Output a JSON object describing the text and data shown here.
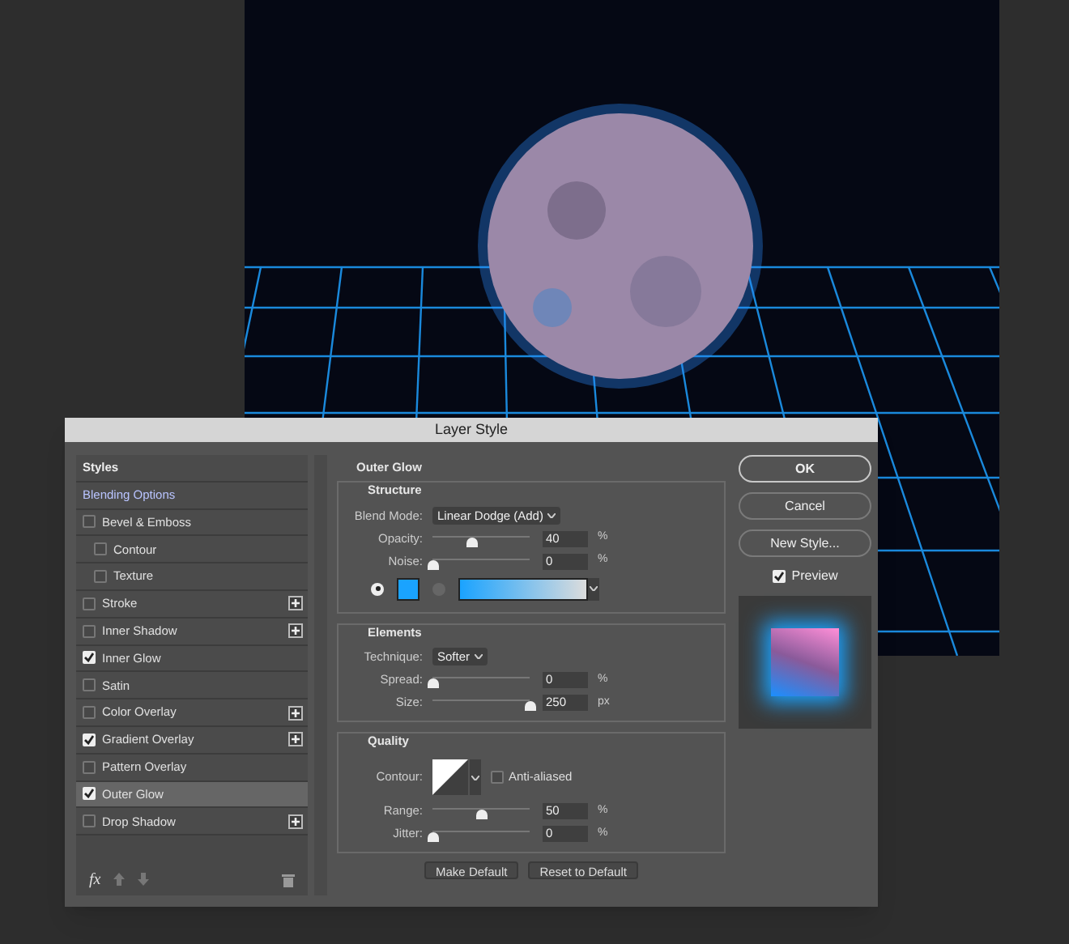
{
  "window": {
    "title": "Layer Style"
  },
  "styles_list": [
    {
      "label": "Styles",
      "kind": "heading",
      "selected": false
    },
    {
      "label": "Blending Options",
      "kind": "options",
      "selected": false
    },
    {
      "label": "Bevel & Emboss",
      "kind": "effect",
      "checked": false,
      "selected": false,
      "addable": false,
      "children": [
        {
          "label": "Contour",
          "kind": "effect",
          "checked": false,
          "selected": false,
          "addable": false
        },
        {
          "label": "Texture",
          "kind": "effect",
          "checked": false,
          "selected": false,
          "addable": false
        }
      ]
    },
    {
      "label": "Stroke",
      "kind": "effect",
      "checked": false,
      "selected": false,
      "addable": true
    },
    {
      "label": "Inner Shadow",
      "kind": "effect",
      "checked": false,
      "selected": false,
      "addable": true
    },
    {
      "label": "Inner Glow",
      "kind": "effect",
      "checked": true,
      "selected": false,
      "addable": false
    },
    {
      "label": "Satin",
      "kind": "effect",
      "checked": false,
      "selected": false,
      "addable": false
    },
    {
      "label": "Color Overlay",
      "kind": "effect",
      "checked": false,
      "selected": false,
      "addable": true
    },
    {
      "label": "Gradient Overlay",
      "kind": "effect",
      "checked": true,
      "selected": false,
      "addable": true
    },
    {
      "label": "Pattern Overlay",
      "kind": "effect",
      "checked": false,
      "selected": false,
      "addable": false
    },
    {
      "label": "Outer Glow",
      "kind": "effect",
      "checked": true,
      "selected": true,
      "addable": false
    },
    {
      "label": "Drop Shadow",
      "kind": "effect",
      "checked": false,
      "selected": false,
      "addable": true
    }
  ],
  "fx_label": "fx",
  "panel": {
    "title": "Outer Glow",
    "sections": [
      {
        "title": "Structure",
        "rows": [
          {
            "kind": "select",
            "label": "Blend Mode:",
            "value": "Linear Dodge (Add)"
          },
          {
            "kind": "slider",
            "label": "Opacity:",
            "level": 0.4,
            "value": "40",
            "unit": "%"
          },
          {
            "kind": "slider",
            "label": "Noise:",
            "level": 0,
            "value": "0",
            "unit": "%"
          },
          {
            "kind": "fill",
            "options": [
              {
                "kind": "color",
                "color": "#1aa3ff",
                "selected": true
              },
              {
                "kind": "gradient",
                "selected": false
              }
            ]
          }
        ]
      },
      {
        "title": "Elements",
        "rows": [
          {
            "kind": "select",
            "label": "Technique:",
            "value": "Softer"
          },
          {
            "kind": "slider",
            "label": "Spread:",
            "level": 0,
            "value": "0",
            "unit": "%"
          },
          {
            "kind": "slider",
            "label": "Size:",
            "level": 1,
            "value": "250",
            "unit": "px"
          }
        ]
      },
      {
        "title": "Quality",
        "rows": [
          {
            "kind": "contour",
            "label": "Contour:",
            "checkbox": {
              "label": "Anti-aliased",
              "checked": false
            }
          },
          {
            "kind": "slider",
            "label": "Range:",
            "level": 0.5,
            "value": "50",
            "unit": "%"
          },
          {
            "kind": "slider",
            "label": "Jitter:",
            "level": 0,
            "value": "0",
            "unit": "%"
          }
        ]
      }
    ],
    "buttons": [
      "Make Default",
      "Reset to Default"
    ]
  },
  "side_buttons": [
    {
      "label": "OK",
      "primary": true
    },
    {
      "label": "Cancel",
      "primary": false
    },
    {
      "label": "New Style...",
      "primary": false
    }
  ],
  "preview": {
    "label": "Preview",
    "checked": true
  }
}
